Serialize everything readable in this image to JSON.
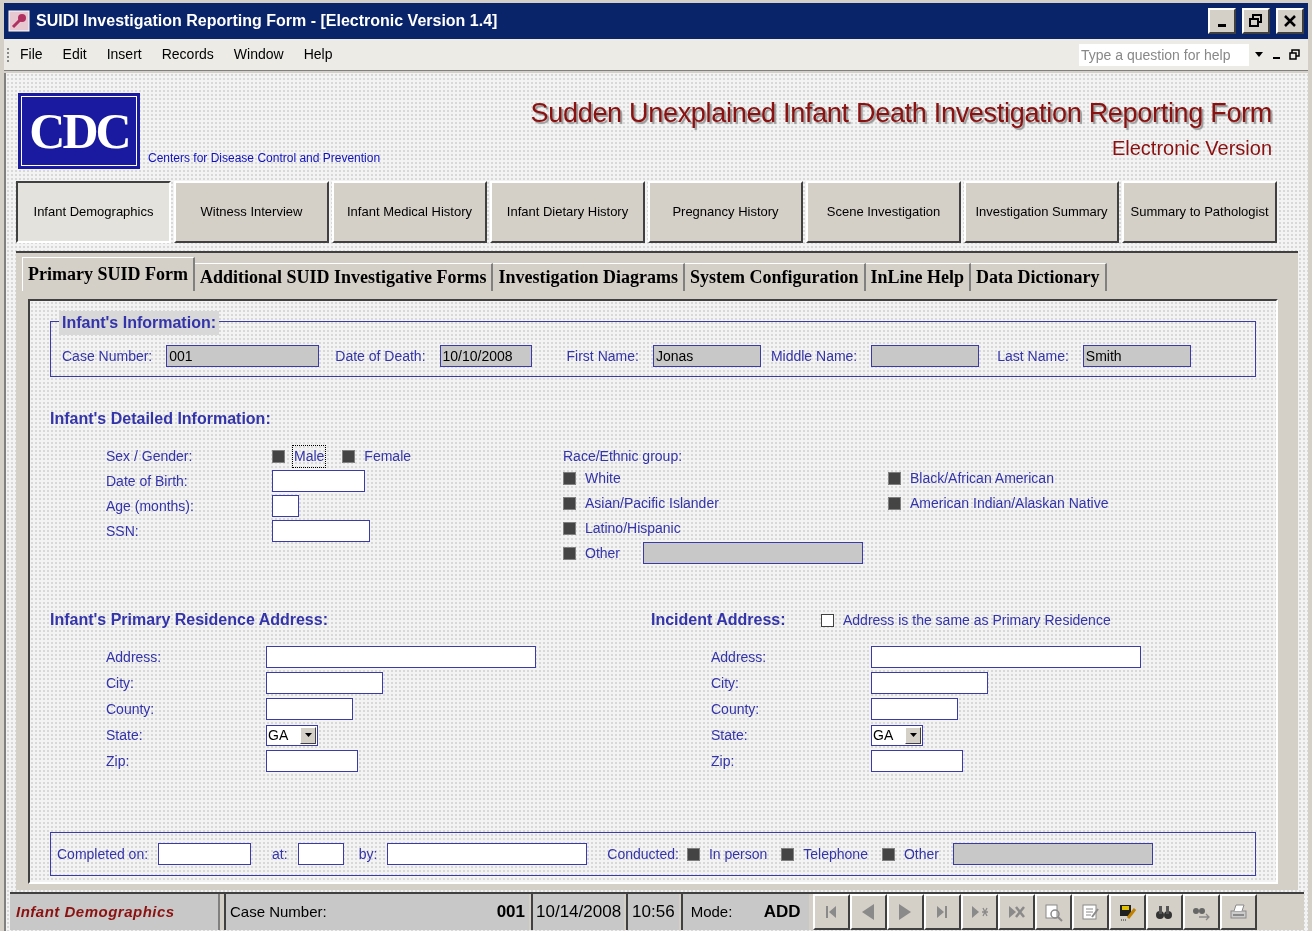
{
  "window": {
    "title": "SUIDI Investigation Reporting Form - [Electronic Version 1.4]"
  },
  "menu": [
    "File",
    "Edit",
    "Insert",
    "Records",
    "Window",
    "Help"
  ],
  "help_box": {
    "placeholder": "Type a question for help"
  },
  "header": {
    "logo": "CDC",
    "org": "Centers for Disease Control and Prevention",
    "title": "Sudden Unexplained Infant Death Investigation Reporting Form",
    "subtitle": "Electronic Version"
  },
  "sections": [
    {
      "label": "Infant Demographics",
      "selected": true
    },
    {
      "label": "Witness Interview",
      "selected": false
    },
    {
      "label": "Infant Medical History",
      "selected": false
    },
    {
      "label": "Infant Dietary History",
      "selected": false
    },
    {
      "label": "Pregnancy History",
      "selected": false
    },
    {
      "label": "Scene Investigation",
      "selected": false
    },
    {
      "label": "Investigation Summary",
      "selected": false
    },
    {
      "label": "Summary to Pathologist",
      "selected": false
    }
  ],
  "tabs": [
    {
      "label": "Primary SUID Form",
      "selected": true
    },
    {
      "label": "Additional SUID Investigative Forms",
      "selected": false
    },
    {
      "label": "Investigation Diagrams",
      "selected": false
    },
    {
      "label": "System Configuration",
      "selected": false
    },
    {
      "label": "InLine Help",
      "selected": false
    },
    {
      "label": "Data Dictionary",
      "selected": false
    }
  ],
  "infant_information": {
    "title": "Infant's Information:",
    "fields": [
      {
        "label": "Case Number:",
        "value": "001"
      },
      {
        "label": "Date of Death:",
        "value": "10/10/2008"
      },
      {
        "label": "First Name:",
        "value": "Jonas"
      },
      {
        "label": "Middle Name:"
      },
      {
        "label": "Last Name:",
        "value": "Smith"
      }
    ]
  },
  "detailed": {
    "title": "Infant's Detailed Information:",
    "sex": {
      "label": "Sex / Gender:",
      "options": [
        {
          "label": "Male",
          "indeterminate": true,
          "focused": true
        },
        {
          "label": "Female",
          "indeterminate": true,
          "focused": false
        }
      ]
    },
    "fields": [
      {
        "label": "Date of Birth:"
      },
      {
        "label": "Age (months):"
      },
      {
        "label": "SSN:"
      }
    ],
    "race": {
      "label": "Race/Ethnic group:",
      "options": [
        {
          "label": "White",
          "indeterminate": true
        },
        {
          "label": "Asian/Pacific Islander",
          "indeterminate": true
        },
        {
          "label": "Latino/Hispanic",
          "indeterminate": true
        },
        {
          "label": "Other",
          "indeterminate": true,
          "kind": "other"
        },
        {
          "label": "Black/African American",
          "indeterminate": true
        },
        {
          "label": "American Indian/Alaskan Native",
          "indeterminate": true
        }
      ]
    }
  },
  "residence": {
    "title": "Infant's Primary Residence Address:",
    "fields": [
      {
        "label": "Address:",
        "kind": "text"
      },
      {
        "label": "City:",
        "kind": "text"
      },
      {
        "label": "County:",
        "kind": "text"
      },
      {
        "label": "State:",
        "kind": "select",
        "value": "GA"
      },
      {
        "label": "Zip:",
        "kind": "text"
      }
    ]
  },
  "incident": {
    "title": "Incident Address:",
    "same_as": {
      "label": "Address is the same as Primary Residence",
      "indeterminate": false
    },
    "fields": [
      {
        "label": "Address:",
        "kind": "text"
      },
      {
        "label": "City:",
        "kind": "text"
      },
      {
        "label": "County:",
        "kind": "text"
      },
      {
        "label": "State:",
        "kind": "select",
        "value": "GA"
      },
      {
        "label": "Zip:",
        "kind": "text"
      }
    ]
  },
  "completion": {
    "fields": [
      {
        "label": "Completed on:"
      },
      {
        "label": "at:"
      },
      {
        "label": "by:"
      }
    ],
    "conducted": {
      "label": "Conducted:",
      "options": [
        {
          "label": "In person",
          "indeterminate": true
        },
        {
          "label": "Telephone",
          "indeterminate": true
        },
        {
          "label": "Other",
          "indeterminate": true
        }
      ]
    }
  },
  "status_bar": {
    "form": "Infant Demographics",
    "case_label": "Case Number:",
    "case_value": "001",
    "date": "10/14/2008",
    "time": "10:56",
    "mode_label": "Mode:",
    "mode_value": "ADD"
  },
  "nav_buttons": [
    {
      "kind": "first"
    },
    {
      "kind": "previous"
    },
    {
      "kind": "next"
    },
    {
      "kind": "last"
    },
    {
      "kind": "new"
    },
    {
      "kind": "delete"
    },
    {
      "kind": "preview"
    },
    {
      "kind": "edit"
    },
    {
      "kind": "save"
    },
    {
      "kind": "find"
    },
    {
      "kind": "replace"
    },
    {
      "kind": "print"
    }
  ]
}
